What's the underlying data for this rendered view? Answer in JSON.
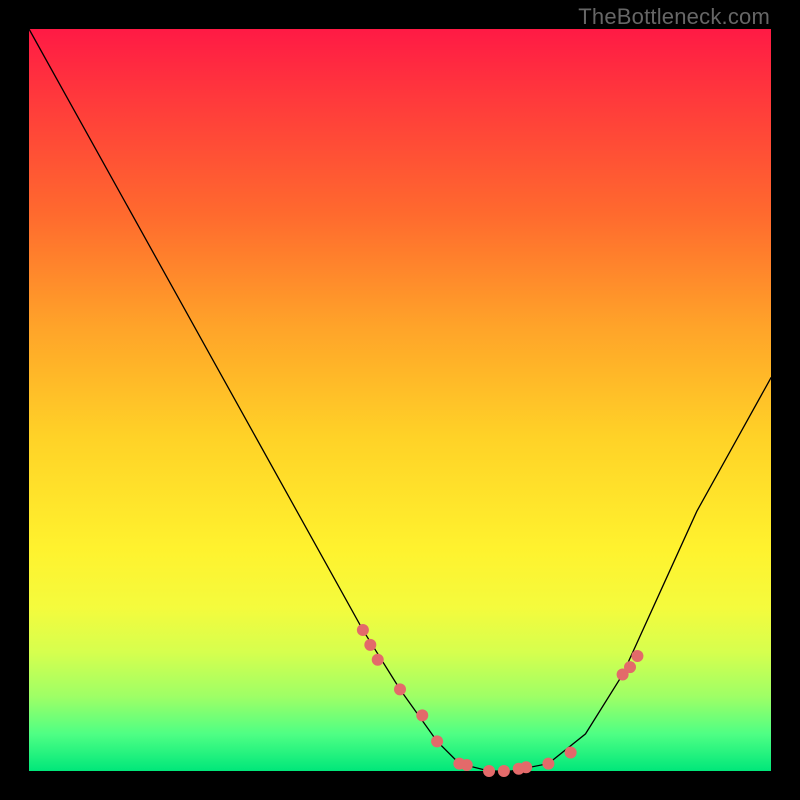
{
  "watermark": "TheBottleneck.com",
  "chart_data": {
    "type": "line",
    "title": "",
    "xlabel": "",
    "ylabel": "",
    "xlim": [
      0,
      100
    ],
    "ylim": [
      0,
      100
    ],
    "grid": false,
    "legend": false,
    "series": [
      {
        "name": "curve",
        "x": [
          0,
          5,
          10,
          15,
          20,
          25,
          30,
          35,
          40,
          45,
          50,
          55,
          58,
          62,
          65,
          70,
          75,
          80,
          85,
          90,
          95,
          100
        ],
        "y": [
          100,
          91,
          82,
          73,
          64,
          55,
          46,
          37,
          28,
          19,
          11,
          4,
          1,
          0,
          0,
          1,
          5,
          13,
          24,
          35,
          44,
          53
        ],
        "color": "#000000",
        "stroke_width": 1.3
      }
    ],
    "markers": {
      "name": "dots",
      "color": "#e36a6a",
      "radius_px": 6,
      "x": [
        45,
        46,
        47,
        50,
        53,
        55,
        58,
        59,
        62,
        64,
        66,
        67,
        70,
        73,
        80,
        81,
        82
      ],
      "y": [
        19,
        17,
        15,
        11,
        7.5,
        4,
        1,
        0.8,
        0,
        0,
        0.3,
        0.5,
        1,
        2.5,
        13,
        14,
        15.5
      ]
    },
    "background": {
      "type": "vertical-gradient",
      "stops": [
        {
          "pos": 0.0,
          "color": "#ff1a45"
        },
        {
          "pos": 0.1,
          "color": "#ff3b3b"
        },
        {
          "pos": 0.25,
          "color": "#ff6a2e"
        },
        {
          "pos": 0.4,
          "color": "#ffa329"
        },
        {
          "pos": 0.55,
          "color": "#ffd227"
        },
        {
          "pos": 0.7,
          "color": "#fff22e"
        },
        {
          "pos": 0.78,
          "color": "#f4fb3d"
        },
        {
          "pos": 0.84,
          "color": "#d6ff4e"
        },
        {
          "pos": 0.9,
          "color": "#9eff66"
        },
        {
          "pos": 0.95,
          "color": "#4fff84"
        },
        {
          "pos": 1.0,
          "color": "#00e77a"
        }
      ]
    },
    "note": "No numeric axes or tick labels are visible; x and y are normalized 0-100 estimates read from pixel positions."
  }
}
